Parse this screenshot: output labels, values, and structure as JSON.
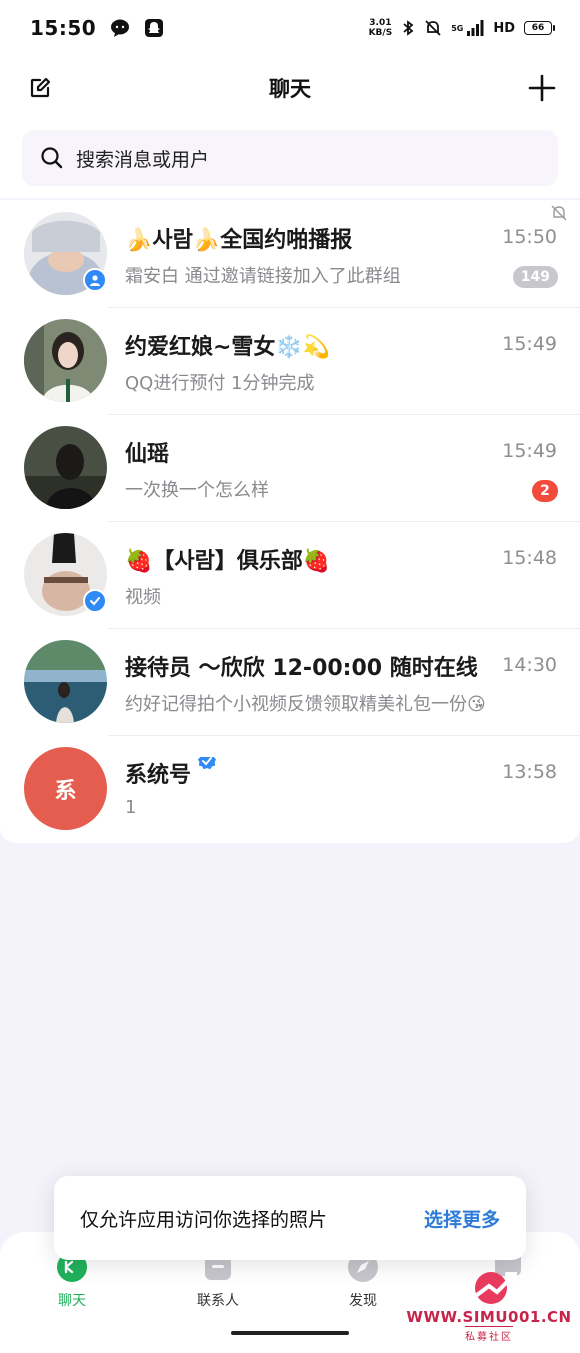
{
  "status_bar": {
    "time": "15:50",
    "net_speed_value": "3.01",
    "net_speed_unit": "KB/S",
    "signal_label": "5G",
    "hd": "HD",
    "battery": "66"
  },
  "header": {
    "title": "聊天"
  },
  "search": {
    "placeholder": "搜索消息或用户"
  },
  "chats": [
    {
      "name": "🍌사람🍌全国约啪播报",
      "time": "15:50",
      "preview": "霜安白 通过邀请链接加入了此群组",
      "badge": "149",
      "badge_style": "muted",
      "avatar_badge": "group",
      "muted": true,
      "avatar_color": "#c8ccd6"
    },
    {
      "name": "约爱红娘~雪女❄️💫",
      "time": "15:49",
      "preview": "QQ进行预付 1分钟完成",
      "badge": "",
      "avatar_color": "#6f7b6b"
    },
    {
      "name": "仙瑶",
      "time": "15:49",
      "preview": "一次换一个怎么样",
      "badge": "2",
      "badge_style": "red",
      "avatar_color": "#3a3f36"
    },
    {
      "name": "🍓【사람】俱乐部🍓",
      "time": "15:48",
      "preview": "视频",
      "badge": "",
      "avatar_badge": "verified",
      "avatar_color": "#d9c8c0"
    },
    {
      "name": "接待员 ～欣欣 12-00:00 随时在线",
      "time": "14:30",
      "preview": "约好记得拍个小视频反馈领取精美礼包一份😘",
      "badge": "",
      "avatar_color": "#3f6a7c"
    },
    {
      "name": "系统号",
      "time": "13:58",
      "preview": "1",
      "badge": "",
      "avatar_text": "系",
      "avatar_color": "#e45d4e",
      "verified_name": true
    }
  ],
  "toast": {
    "message": "仅允许应用访问你选择的照片",
    "action": "选择更多"
  },
  "bottom_nav": [
    {
      "label": "聊天",
      "icon": "chat-icon",
      "active": true
    },
    {
      "label": "联系人",
      "icon": "contacts-icon",
      "active": false
    },
    {
      "label": "发现",
      "icon": "discover-icon",
      "active": false
    }
  ],
  "watermark": {
    "text": "WWW.SIMU001.CN",
    "sub": "私募社区"
  },
  "colors": {
    "accent_green": "#21b15c",
    "badge_red": "#f24a3b",
    "badge_muted": "#c7c7cc",
    "link_blue": "#2f7bd8",
    "system_avatar": "#e45d4e",
    "watermark": "#c8244b"
  }
}
